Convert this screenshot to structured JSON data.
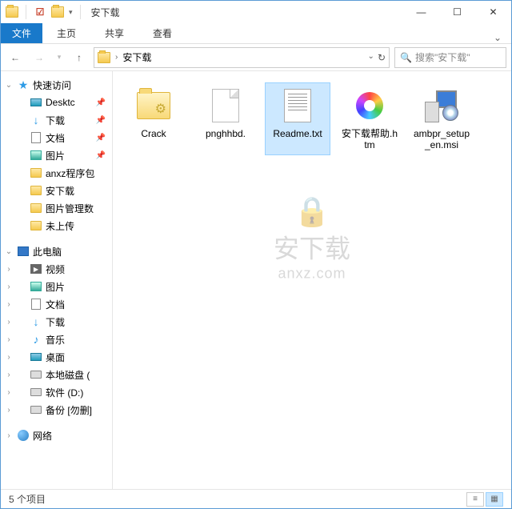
{
  "title": "安下载",
  "ribbon": {
    "file": "文件",
    "home": "主页",
    "share": "共享",
    "view": "查看"
  },
  "address": {
    "folder": "安下载"
  },
  "search": {
    "placeholder": "搜索\"安下载\""
  },
  "sidebar": {
    "quick_access": "快速访问",
    "items": [
      {
        "label": "Desktc",
        "pinned": true
      },
      {
        "label": "下载",
        "pinned": true
      },
      {
        "label": "文档",
        "pinned": true
      },
      {
        "label": "图片",
        "pinned": true
      },
      {
        "label": "anxz程序包"
      },
      {
        "label": "安下载"
      },
      {
        "label": "图片管理数"
      },
      {
        "label": "未上传"
      }
    ],
    "this_pc": "此电脑",
    "pc_items": [
      {
        "label": "视频"
      },
      {
        "label": "图片"
      },
      {
        "label": "文档"
      },
      {
        "label": "下载"
      },
      {
        "label": "音乐"
      },
      {
        "label": "桌面"
      },
      {
        "label": "本地磁盘 ("
      },
      {
        "label": "软件 (D:)"
      },
      {
        "label": "备份 [勿删]"
      }
    ],
    "network": "网络"
  },
  "files": [
    {
      "name": "Crack",
      "type": "folder-gear"
    },
    {
      "name": "pnghhbd.",
      "type": "blank"
    },
    {
      "name": "Readme.txt",
      "type": "txt",
      "selected": true
    },
    {
      "name": "安下载帮助.htm",
      "type": "htm"
    },
    {
      "name": "ambpr_setup_en.msi",
      "type": "msi"
    }
  ],
  "status": {
    "count": "5 个项目"
  },
  "watermark": {
    "cn": "安下载",
    "en": "anxz.com"
  }
}
